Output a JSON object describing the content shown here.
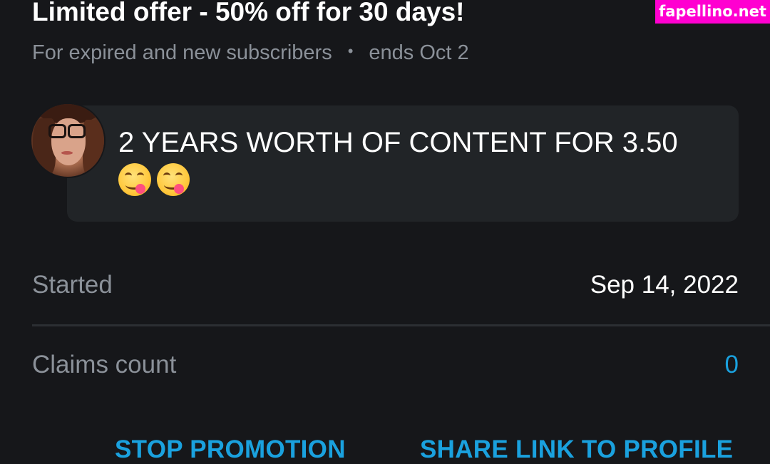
{
  "watermark": {
    "text": "fapellino.net"
  },
  "offer": {
    "title": "Limited offer - 50% off for 30 days!",
    "audience": "For expired and new subscribers",
    "separator": "•",
    "ends": "ends Oct 2"
  },
  "message": {
    "text": "2 YEARS WORTH OF CONTENT FOR 3.50",
    "emojis": [
      "face-savoring-food-emoji",
      "face-savoring-food-emoji"
    ]
  },
  "details": {
    "started_label": "Started",
    "started_value": "Sep 14, 2022",
    "claims_label": "Claims count",
    "claims_value": "0"
  },
  "actions": {
    "stop_label": "STOP PROMOTION",
    "share_label": "SHARE LINK TO PROFILE"
  },
  "colors": {
    "background": "#16171a",
    "bubble": "#212427",
    "accent": "#1aa1de",
    "muted_text": "#8b9199",
    "watermark": "#ff00d0"
  }
}
